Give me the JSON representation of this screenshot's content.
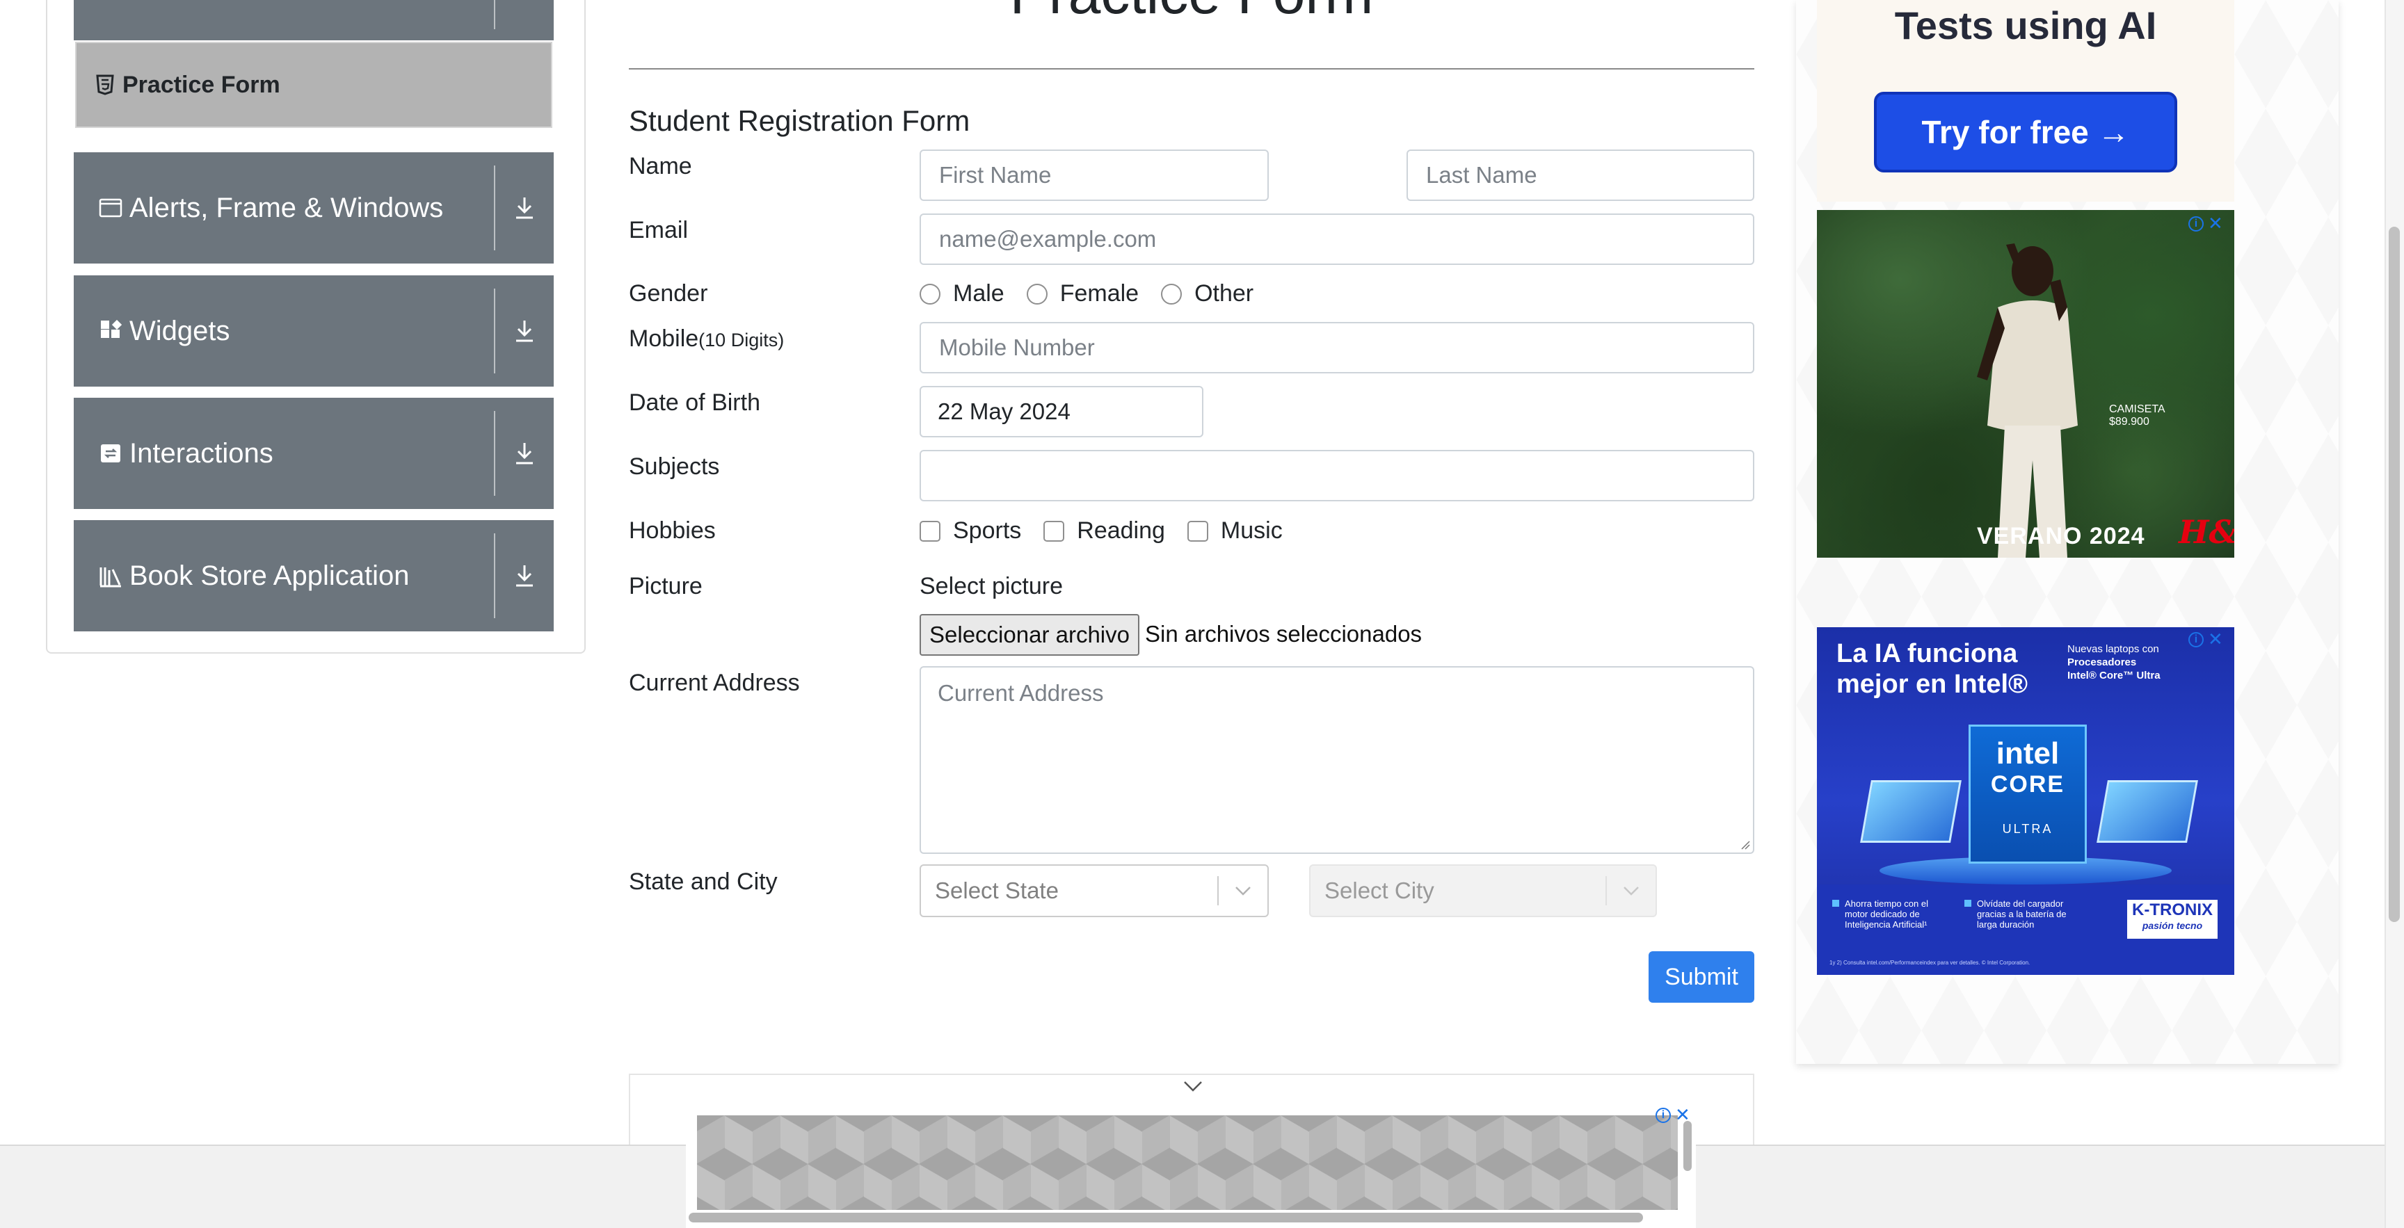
{
  "sidebar": {
    "active_item": {
      "label": "Practice Form",
      "icon": "html5-icon"
    },
    "groups": [
      {
        "label": "Alerts, Frame & Windows",
        "icon": "window-icon",
        "arrow_icon": "download-arrow-icon"
      },
      {
        "label": "Widgets",
        "icon": "widgets-grid-icon",
        "arrow_icon": "download-arrow-icon"
      },
      {
        "label": "Interactions",
        "icon": "interactions-icon",
        "arrow_icon": "download-arrow-icon"
      },
      {
        "label": "Book Store Application",
        "icon": "library-icon",
        "arrow_icon": "download-arrow-icon"
      }
    ],
    "header_color": "#6c757d",
    "active_color": "#b3b3b3"
  },
  "form": {
    "heading": "Practice Form",
    "section_title": "Student Registration Form",
    "name": {
      "label": "Name",
      "first_placeholder": "First Name",
      "last_placeholder": "Last Name"
    },
    "email": {
      "label": "Email",
      "placeholder": "name@example.com"
    },
    "gender": {
      "label": "Gender",
      "options": [
        "Male",
        "Female",
        "Other"
      ]
    },
    "mobile": {
      "label": "Mobile",
      "label_suffix": "(10 Digits)",
      "placeholder": "Mobile Number"
    },
    "dob": {
      "label": "Date of Birth",
      "value": "22 May 2024"
    },
    "subjects": {
      "label": "Subjects",
      "value": ""
    },
    "hobbies": {
      "label": "Hobbies",
      "options": [
        "Sports",
        "Reading",
        "Music"
      ]
    },
    "picture": {
      "label": "Picture",
      "select_label": "Select picture",
      "button_label": "Seleccionar archivo",
      "status": "Sin archivos seleccionados"
    },
    "address": {
      "label": "Current Address",
      "placeholder": "Current Address"
    },
    "state_city": {
      "label": "State and City",
      "state_placeholder": "Select State",
      "city_placeholder": "Select City"
    },
    "submit_label": "Submit",
    "submit_color": "#2f80ed"
  },
  "ads": {
    "ai_ad": {
      "headline": "Tests using AI",
      "button_label": "Try for free →",
      "button_color": "#1d4ee6"
    },
    "hm_ad": {
      "product_line1": "CAMISETA",
      "product_line2": "$89.900",
      "tagline": "VERANO 2024",
      "brand": "H&M"
    },
    "intel_ad": {
      "headline": "La IA funciona mejor en Intel®",
      "side_line1": "Nuevas laptops con",
      "side_line2": "Procesadores",
      "side_line3": "Intel® Core™ Ultra",
      "chip_line1": "intel",
      "chip_line2": "CORE",
      "chip_line3": "ULTRA",
      "bullet1": "Ahorra tiempo con el motor dedicado de Inteligencia Artificial¹",
      "bullet2": "Olvídate del cargador gracias a la batería de larga duración",
      "retailer": "K-TRONIX",
      "retailer_tagline": "pasión tecno",
      "footnote": "1y 2) Consulta intel.com/Performanceindex para ver detalles. © Intel Corporation."
    },
    "adchoices_icon": "info-icon",
    "close_icon": "close-icon"
  }
}
